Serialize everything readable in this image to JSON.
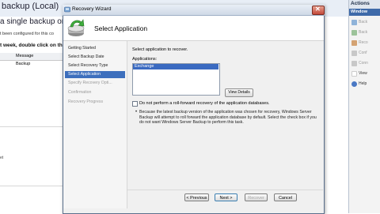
{
  "background": {
    "title": "backup (Local)",
    "subtitle": "a single backup or sche",
    "message1": "t been configured for this co",
    "message2": "t week, double click on the",
    "column_header": "Message",
    "cell": "Backup",
    "left_fragment": "et"
  },
  "actions": {
    "title": "Actions",
    "subtitle": "Window",
    "items": [
      {
        "label": "Back",
        "icon": "backup-schedule-icon",
        "enabled": false
      },
      {
        "label": "Back",
        "icon": "backup-once-icon",
        "enabled": false
      },
      {
        "label": "Reco",
        "icon": "recover-icon",
        "enabled": false
      },
      {
        "label": "Conf",
        "icon": "configure-icon",
        "enabled": false
      },
      {
        "label": "Conn",
        "icon": "connect-icon",
        "enabled": false
      },
      {
        "label": "View",
        "icon": "view-icon",
        "enabled": true
      },
      {
        "label": "Help",
        "icon": "help-icon",
        "enabled": true
      }
    ]
  },
  "dialog": {
    "title": "Recovery Wizard",
    "page_title": "Select Application",
    "nav": [
      {
        "label": "Getting Started",
        "state": "normal"
      },
      {
        "label": "Select Backup Date",
        "state": "normal"
      },
      {
        "label": "Select Recovery Type",
        "state": "normal"
      },
      {
        "label": "Select Application",
        "state": "active"
      },
      {
        "label": "Specify Recovery Opti...",
        "state": "disabled"
      },
      {
        "label": "Confirmation",
        "state": "disabled"
      },
      {
        "label": "Recovery Progress",
        "state": "disabled"
      }
    ],
    "select_label": "Select application to recover.",
    "apps_label": "Applications:",
    "applications": [
      "Exchange"
    ],
    "view_details": "View Details",
    "checkbox_label": "Do not perform a roll-forward recovery of the application databases.",
    "checkbox_checked": false,
    "note": "Because the latest backup version of the application was chosen for recovery, Windows Server Backup will attempt to roll forward the application database by default. Select the check box if you do not want Windows Server Backup to perform this task.",
    "buttons": {
      "previous": "< Previous",
      "next": "Next >",
      "recover": "Recover",
      "cancel": "Cancel"
    }
  },
  "colors": {
    "accent": "#3d6fbd",
    "selection": "#3a6ac1",
    "actions_header": "#3e6aa9"
  }
}
